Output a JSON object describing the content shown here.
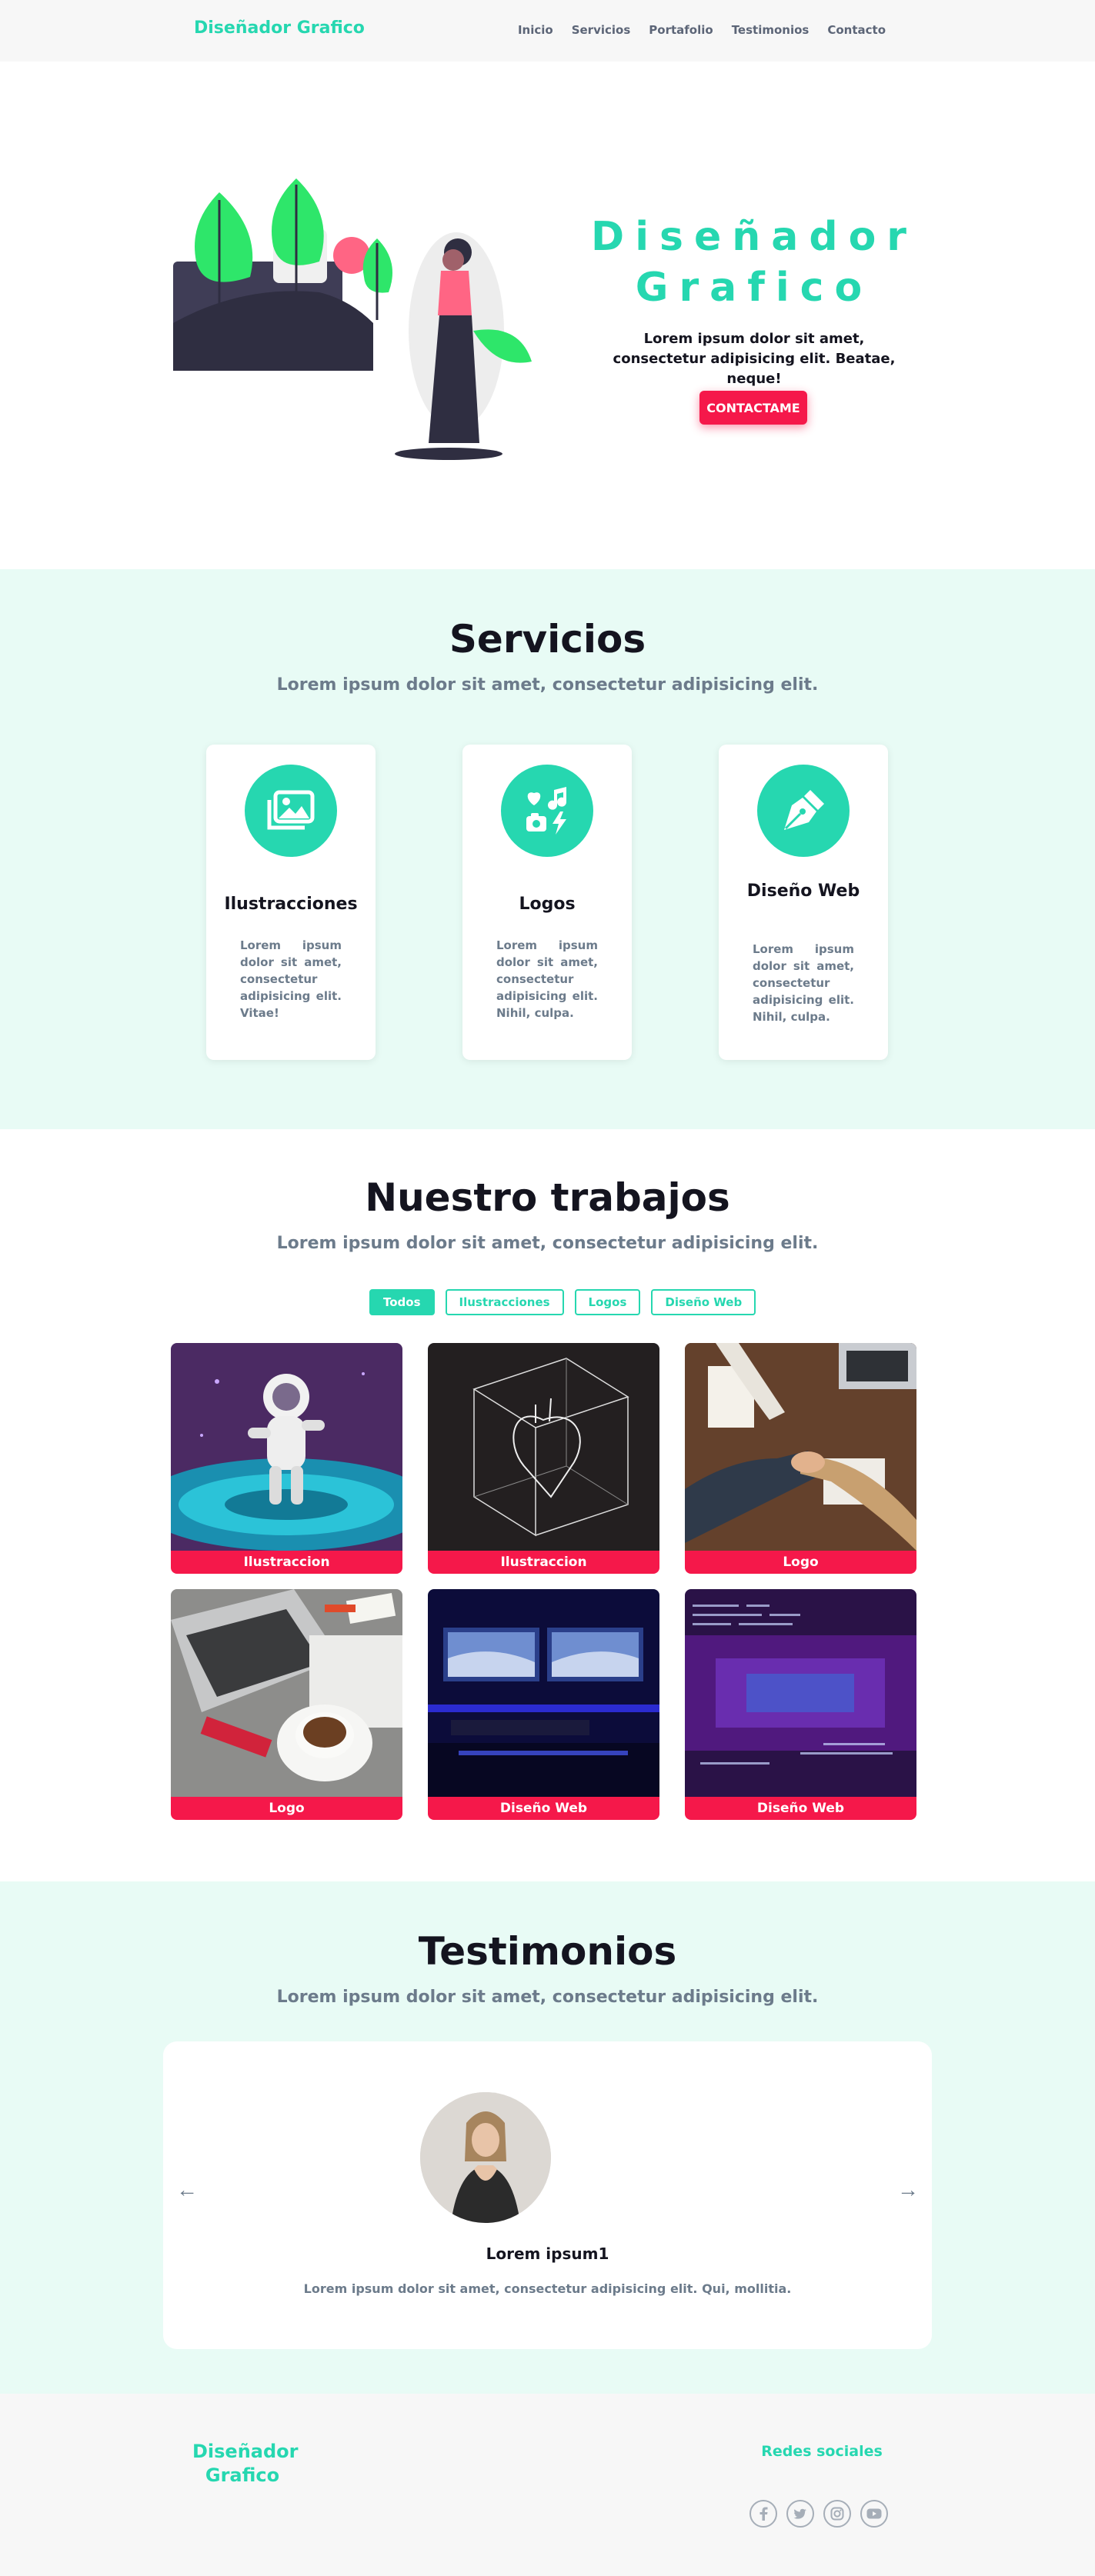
{
  "nav": {
    "brand": "Diseñador Grafico",
    "links": [
      "Inicio",
      "Servicios",
      "Portafolio",
      "Testimonios",
      "Contacto"
    ]
  },
  "hero": {
    "title_line1": "Diseñador",
    "title_line2": "Grafico",
    "subtitle": "Lorem ipsum dolor sit amet, consectetur adipisicing elit. Beatae, neque!",
    "cta": "CONTACTAME"
  },
  "servicios": {
    "title": "Servicios",
    "subtitle": "Lorem ipsum dolor sit amet, consectetur adipisicing elit.",
    "cards": [
      {
        "icon": "images-icon",
        "title": "Ilustracciones",
        "text": "Lorem ipsum dolor sit amet, consectetur adipisicing elit. Vitae!"
      },
      {
        "icon": "media-icon",
        "title": "Logos",
        "text": "Lorem ipsum dolor sit amet, consectetur adipisicing elit. Nihil, culpa."
      },
      {
        "icon": "pen-nib-icon",
        "title": "Diseño Web",
        "text": "Lorem ipsum dolor sit amet, consectetur adipisicing elit. Nihil, culpa."
      }
    ]
  },
  "trabajos": {
    "title": "Nuestro trabajos",
    "subtitle": "Lorem ipsum dolor sit amet, consectetur adipisicing elit.",
    "filters": [
      "Todos",
      "Ilustracciones",
      "Logos",
      "Diseño Web"
    ],
    "active_filter": "Todos",
    "items": [
      {
        "label": "Ilustraccion",
        "image": "astronaut-illustration"
      },
      {
        "label": "Ilustraccion",
        "image": "heart-cube-illustration"
      },
      {
        "label": "Logo",
        "image": "handshake-desk-photo"
      },
      {
        "label": "Logo",
        "image": "laptop-coffee-photo"
      },
      {
        "label": "Diseño Web",
        "image": "monitors-desk-photo"
      },
      {
        "label": "Diseño Web",
        "image": "code-screen-photo"
      }
    ]
  },
  "testimonios": {
    "title": "Testimonios",
    "subtitle": "Lorem ipsum dolor sit amet, consectetur adipisicing elit.",
    "name": "Lorem ipsum1",
    "text": "Lorem ipsum dolor sit amet, consectetur adipisicing elit. Qui, mollitia."
  },
  "footer": {
    "brand": "Diseñador Grafico",
    "social_title": "Redes sociales",
    "socials": [
      "facebook-icon",
      "twitter-icon",
      "instagram-icon",
      "youtube-icon"
    ]
  },
  "colors": {
    "accent": "#26d7b0",
    "cta": "#f5184a",
    "section_tint": "#e8fbf5",
    "muted_text": "#6c7b8b"
  }
}
